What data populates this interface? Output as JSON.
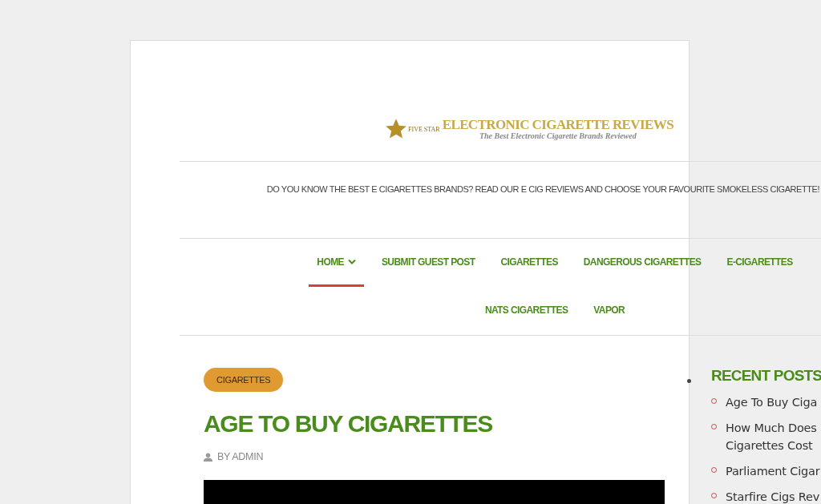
{
  "logo": {
    "badge": "FIVE STAR",
    "title": "ELECTRONIC CIGARETTE REVIEWS",
    "subtitle": "The Best Electronic Cigarette Brands Reviewed"
  },
  "tagline": "DO YOU KNOW THE BEST E CIGARETTES BRANDS? READ OUR E CIG REVIEWS AND CHOOSE YOUR FAVOURITE SMOKELESS CIGARETTE!",
  "nav": [
    {
      "label": "HOME",
      "selected": true,
      "has_submenu": true
    },
    {
      "label": "SUBMIT GUEST POST",
      "selected": false,
      "has_submenu": false
    },
    {
      "label": "CIGARETTES",
      "selected": false,
      "has_submenu": false
    },
    {
      "label": "DANGEROUS CIGARETTES",
      "selected": false,
      "has_submenu": false
    },
    {
      "label": "E-CIGARETTES",
      "selected": false,
      "has_submenu": false
    },
    {
      "label": "NATS CIGARETTES",
      "selected": false,
      "has_submenu": false
    },
    {
      "label": "VAPOR",
      "selected": false,
      "has_submenu": false
    }
  ],
  "post": {
    "category": "CIGARETTES",
    "title": "AGE TO BUY CIGARETTES",
    "author": "BY ADMIN"
  },
  "sidebar": {
    "title": "RECENT POSTS",
    "items": [
      {
        "lines": [
          "Age To Buy Ciga"
        ]
      },
      {
        "lines": [
          "How Much Does",
          "Cigarettes Cost"
        ]
      },
      {
        "lines": [
          "Parliament Cigar"
        ]
      },
      {
        "lines": [
          "Starfire Cigs Rev"
        ]
      }
    ]
  }
}
